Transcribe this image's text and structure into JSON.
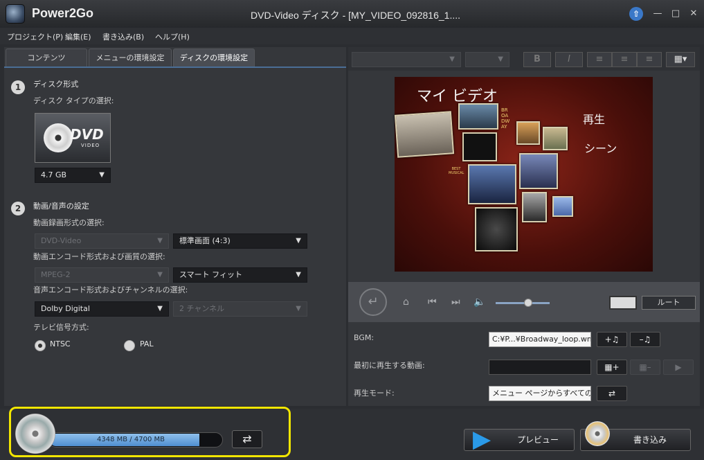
{
  "app": {
    "name": "Power2Go",
    "window_title": "DVD-Video ディスク - [MY_VIDEO_092816_1...."
  },
  "menu": [
    "プロジェクト(P)",
    "編集(E)",
    "書き込み(B)",
    "ヘルプ(H)"
  ],
  "tabs": [
    "コンテンツ",
    "メニューの環境設定",
    "ディスクの環境設定"
  ],
  "active_tab": "ディスクの環境設定",
  "disc": {
    "step1_num": "1",
    "step1_title": "ディスク形式",
    "disc_type_label": "ディスク タイプの選択:",
    "dvd_logo": "DVD",
    "dvd_logo_sub": "VIDEO",
    "capacity": "4.7 GB",
    "step2_num": "2",
    "step2_title": "動画/音声の設定",
    "video_format_label": "動画録画形式の選択:",
    "video_format": "DVD-Video",
    "aspect": "標準画面 (4:3)",
    "encode_label": "動画エンコード形式および画質の選択:",
    "encode": "MPEG-2",
    "quality": "スマート フィット",
    "audio_label": "音声エンコード形式およびチャンネルの選択:",
    "audio": "Dolby Digital",
    "channels": "2 チャンネル",
    "tv_label": "テレビ信号方式:",
    "ntsc": "NTSC",
    "pal": "PAL",
    "tv_selected": "NTSC"
  },
  "format_toolbar": {
    "bold": "B",
    "italic": "I"
  },
  "preview": {
    "title": "マイ ビデオ",
    "play": "再生",
    "scene": "シーン",
    "marquee": "BROADWAY",
    "badge": "BEST MUSICAL"
  },
  "player": {
    "route": "ルート"
  },
  "settings": {
    "bgm_label": "BGM:",
    "bgm_value": "C:¥P...¥Broadway_loop.wma",
    "first_play_label": "最初に再生する動画:",
    "first_play_value": "",
    "play_mode_label": "再生モード:",
    "play_mode_value": "メニュー ページからすべての..."
  },
  "capacity": {
    "text": "4348 MB / 4700 MB",
    "used_fraction": 0.925
  },
  "actions": {
    "preview": "プレビュー",
    "burn": "書き込み"
  },
  "colors": {
    "highlight": "#f2e600",
    "accent": "#4f8ed0",
    "preview_bg": "#6a1a12"
  }
}
